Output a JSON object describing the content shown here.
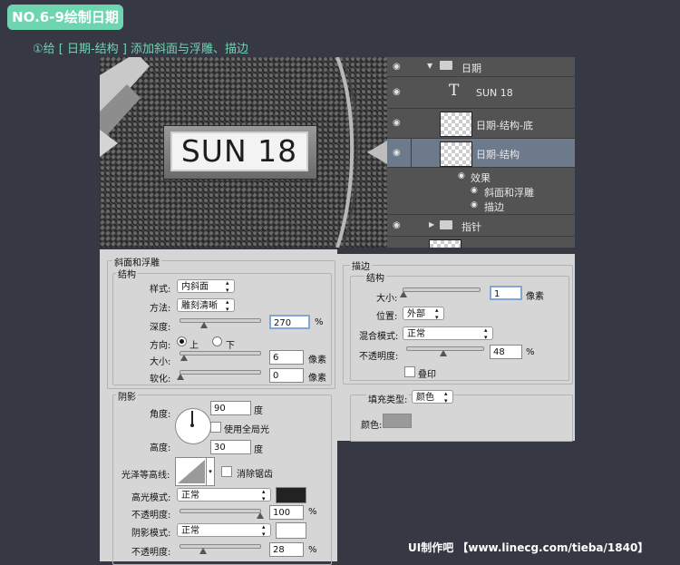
{
  "header": {
    "tag": "NO.6-9绘制日期",
    "instruction": "①给 [ 日期-结构 ] 添加斜面与浮雕、描边"
  },
  "preview": {
    "date_text": "SUN 18"
  },
  "layers": {
    "group_date": "日期",
    "text_layer": "SUN 18",
    "layer_base": "日期-结构-底",
    "layer_struct": "日期-结构",
    "effects_label": "效果",
    "effect_bevel": "斜面和浮雕",
    "effect_stroke": "描边",
    "group_hands": "指针"
  },
  "bevel": {
    "title": "斜面和浮雕",
    "structure_label": "结构",
    "style_label": "样式:",
    "style_value": "内斜面",
    "technique_label": "方法:",
    "technique_value": "雕刻清晰",
    "depth_label": "深度:",
    "depth_value": "270",
    "depth_unit": "%",
    "depth_level": 0.3,
    "direction_label": "方向:",
    "dir_up": "上",
    "dir_down": "下",
    "size_label": "大小:",
    "size_value": "6",
    "size_unit": "像素",
    "size_level": 0.04,
    "soften_label": "软化:",
    "soften_value": "0",
    "soften_unit": "像素",
    "soften_level": 0.0,
    "shading_label": "阴影",
    "angle_label": "角度:",
    "angle_value": "90",
    "angle_unit": "度",
    "global_light_label": "使用全局光",
    "altitude_label": "高度:",
    "altitude_value": "30",
    "altitude_unit": "度",
    "gloss_label": "光泽等高线:",
    "antialias_label": "消除锯齿",
    "highlight_mode_label": "高光模式:",
    "highlight_mode_value": "正常",
    "highlight_color": "#222222",
    "highlight_opacity_label": "不透明度:",
    "highlight_opacity_value": "100",
    "highlight_opacity_unit": "%",
    "highlight_opacity_level": 1.0,
    "shadow_mode_label": "阴影模式:",
    "shadow_mode_value": "正常",
    "shadow_color": "#ffffff",
    "shadow_opacity_label": "不透明度:",
    "shadow_opacity_value": "28",
    "shadow_opacity_unit": "%",
    "shadow_opacity_level": 0.28
  },
  "stroke": {
    "title": "描边",
    "structure_label": "结构",
    "size_label": "大小:",
    "size_value": "1",
    "size_unit": "像素",
    "size_level": 0.0,
    "position_label": "位置:",
    "position_value": "外部",
    "blend_label": "混合模式:",
    "blend_value": "正常",
    "opacity_label": "不透明度:",
    "opacity_value": "48",
    "opacity_unit": "%",
    "opacity_level": 0.48,
    "overprint_label": "叠印",
    "fill_type_label": "填充类型:",
    "fill_type_value": "颜色",
    "color_label": "颜色:",
    "color_value": "#9a9a9a"
  },
  "watermark": "UI制作吧 【www.linecg.com/tieba/1840】"
}
